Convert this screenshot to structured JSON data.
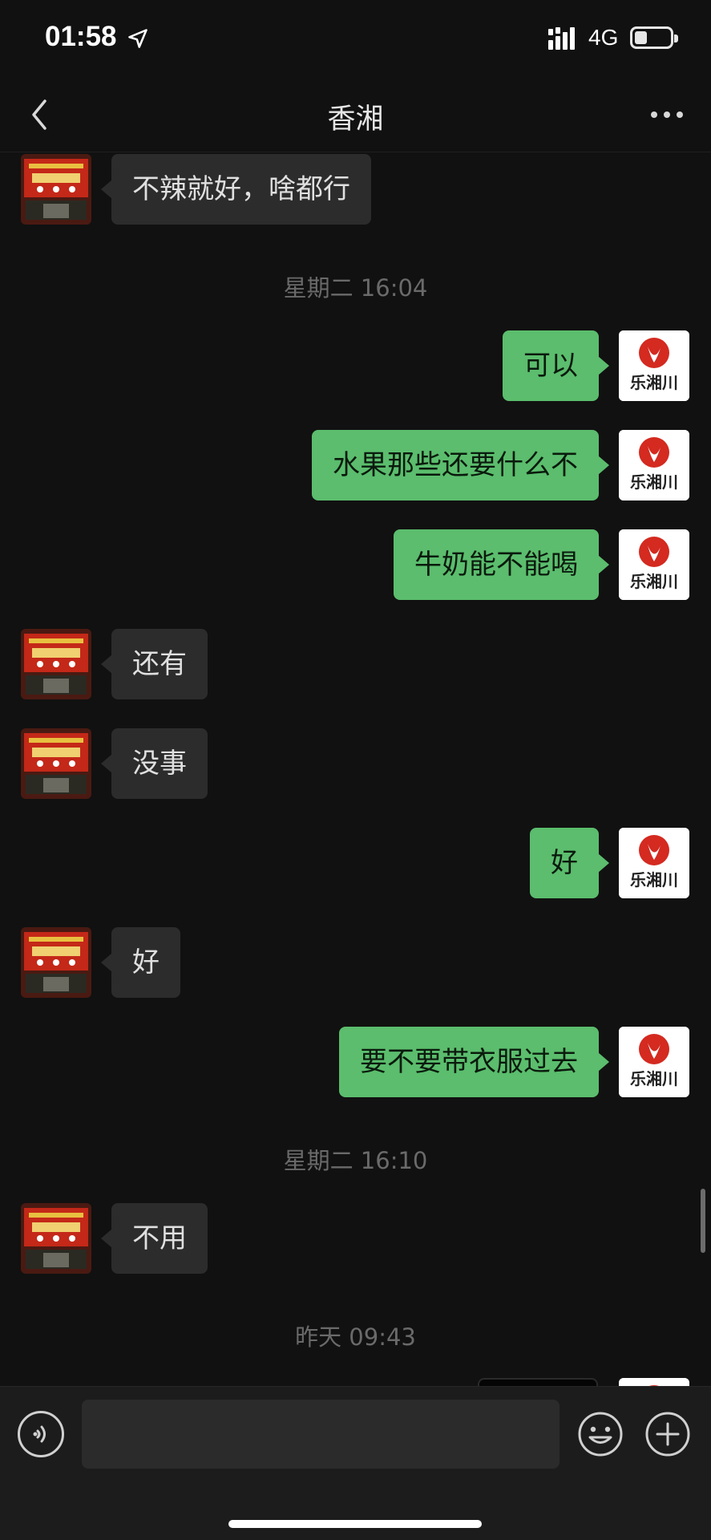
{
  "status_bar": {
    "time": "01:58",
    "network": "4G",
    "battery_level": 0.35
  },
  "header": {
    "title": "香湘"
  },
  "messages": [
    {
      "type": "text",
      "side": "left",
      "text": "不辣就好，啥都行"
    },
    {
      "type": "time",
      "text": "星期二 16:04"
    },
    {
      "type": "text",
      "side": "right",
      "text": "可以"
    },
    {
      "type": "text",
      "side": "right",
      "text": "水果那些还要什么不"
    },
    {
      "type": "text",
      "side": "right",
      "text": "牛奶能不能喝"
    },
    {
      "type": "text",
      "side": "left",
      "text": "还有"
    },
    {
      "type": "text",
      "side": "left",
      "text": "没事"
    },
    {
      "type": "text",
      "side": "right",
      "text": "好"
    },
    {
      "type": "text",
      "side": "left",
      "text": "好"
    },
    {
      "type": "text",
      "side": "right",
      "text": "要不要带衣服过去"
    },
    {
      "type": "time",
      "text": "星期二 16:10"
    },
    {
      "type": "text",
      "side": "left",
      "text": "不用"
    },
    {
      "type": "time",
      "text": "昨天 09:43"
    }
  ],
  "input": {
    "value": "",
    "placeholder": ""
  },
  "colors": {
    "outgoing_bubble": "#5bbd6d",
    "incoming_bubble": "#2c2c2c",
    "background": "#111111"
  },
  "icons": {
    "back": "chevron-left-icon",
    "more": "more-dots-icon",
    "voice": "voice-icon",
    "emoji": "emoji-icon",
    "plus": "plus-icon"
  }
}
